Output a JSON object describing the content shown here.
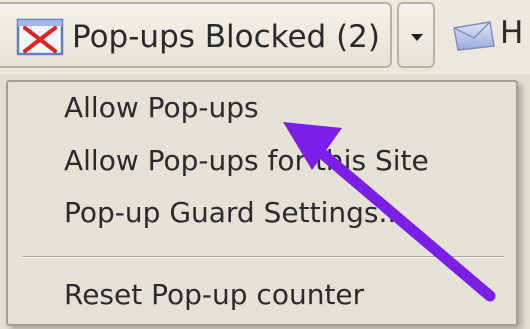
{
  "toolbar": {
    "popup_button_label": "Pop-ups Blocked (2)",
    "popup_icon": "popup-blocked-icon",
    "dropdown_icon": "chevron-down-icon",
    "mail_icon": "mail-icon",
    "next_label_fragment": "H"
  },
  "menu": {
    "items": [
      {
        "label": "Allow Pop-ups"
      },
      {
        "label": "Allow Pop-ups for this Site"
      },
      {
        "label": "Pop-up Guard Settings..."
      },
      {
        "label": "Reset Pop-up counter"
      }
    ]
  },
  "annotation": {
    "arrow_color": "#7a1ee8"
  }
}
